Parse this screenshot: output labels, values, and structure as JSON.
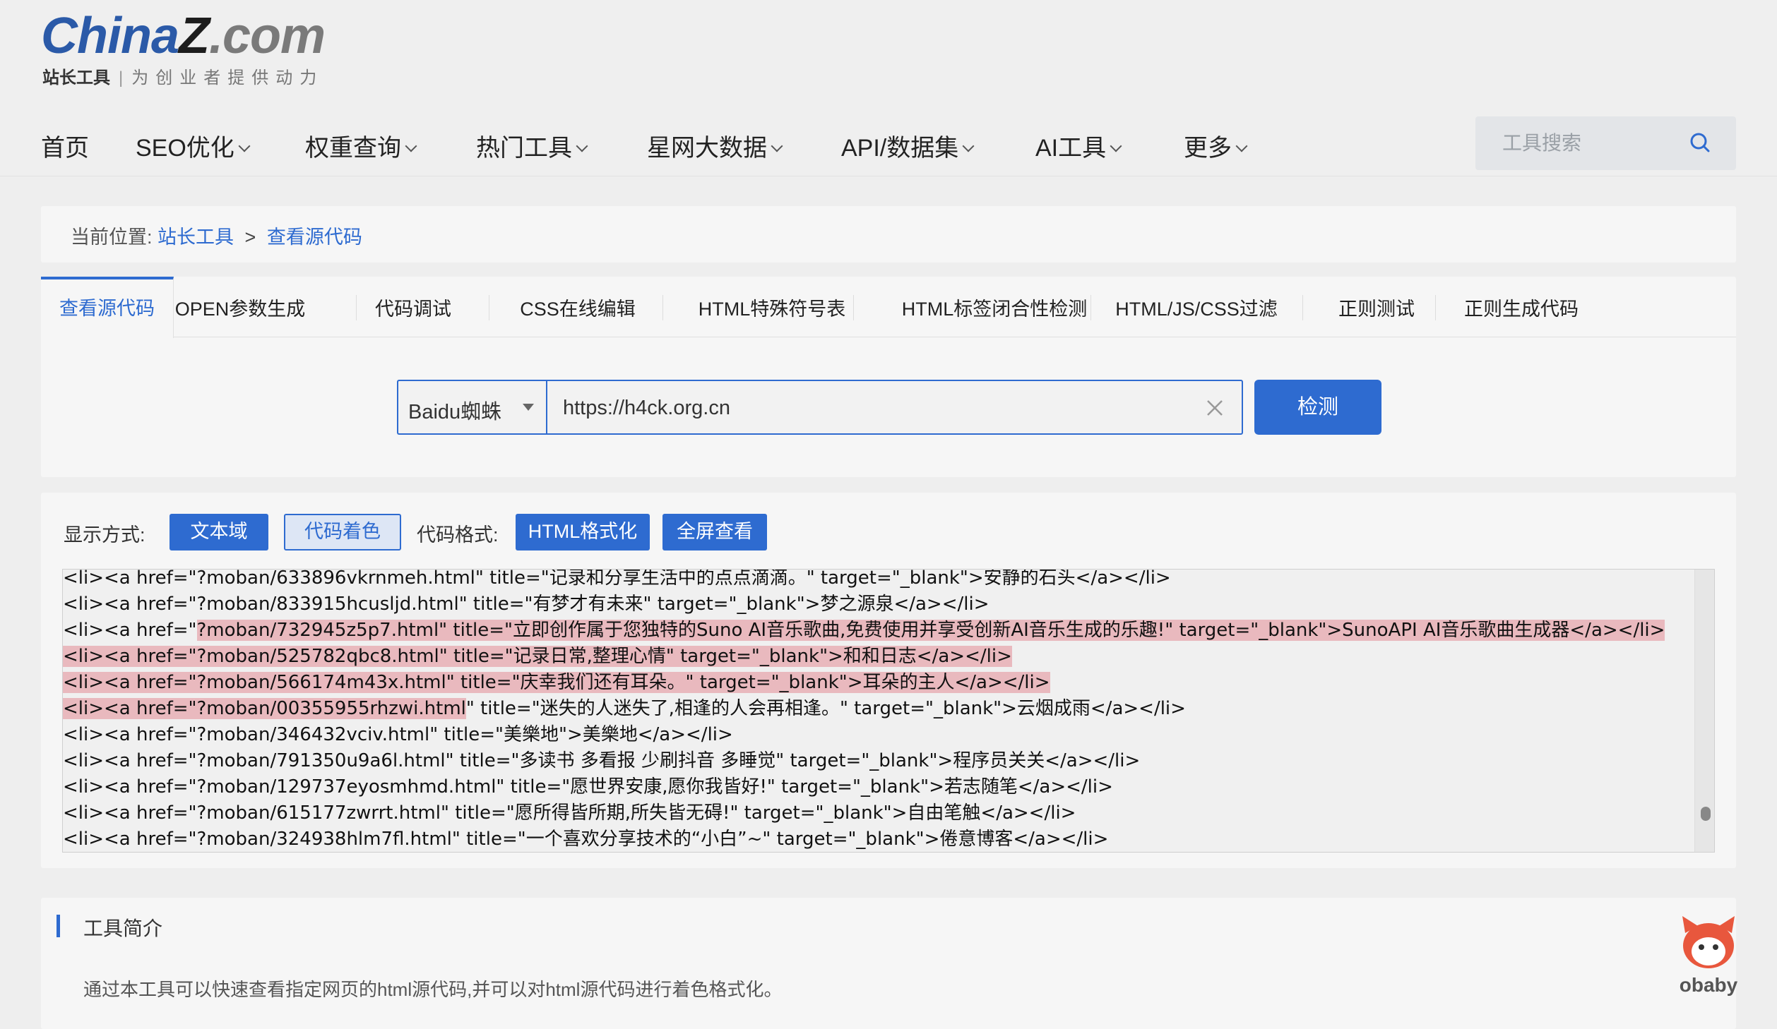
{
  "logo": {
    "brand_part1": "China",
    "brand_part2": "Z",
    "brand_part3": ".com",
    "name": "站长工具",
    "slogan": "为创业者提供动力"
  },
  "nav": {
    "items": [
      {
        "label": "首页",
        "dropdown": false
      },
      {
        "label": "SEO优化",
        "dropdown": true
      },
      {
        "label": "权重查询",
        "dropdown": true
      },
      {
        "label": "热门工具",
        "dropdown": true
      },
      {
        "label": "星网大数据",
        "dropdown": true
      },
      {
        "label": "API/数据集",
        "dropdown": true
      },
      {
        "label": "AI工具",
        "dropdown": true
      },
      {
        "label": "更多",
        "dropdown": true
      }
    ],
    "search_placeholder": "工具搜索"
  },
  "breadcrumb": {
    "prefix": "当前位置:",
    "home": "站长工具",
    "separator": ">",
    "current": "查看源代码"
  },
  "tabs": [
    "查看源代码",
    "OPEN参数生成",
    "代码调试",
    "CSS在线编辑",
    "HTML特殊符号表",
    "HTML标签闭合性检测",
    "HTML/JS/CSS过滤",
    "正则测试",
    "正则生成代码"
  ],
  "form": {
    "ua_selected": "Baidu蜘蛛",
    "url_value": "https://h4ck.org.cn",
    "submit_label": "检测"
  },
  "display": {
    "mode_label": "显示方式:",
    "mode_text": "文本域",
    "mode_color": "代码着色",
    "format_label": "代码格式:",
    "format_html": "HTML格式化",
    "fullscreen": "全屏查看"
  },
  "code_lines": [
    {
      "pre": "<li><a href=\"?moban/633896vkrnmeh.html\" title=\"记录和分享生活中的点点滴滴。\" target=\"_blank\">安静的石头</a></li>",
      "hl": "",
      "post": ""
    },
    {
      "pre": "<li><a href=\"?moban/833915hcusljd.html\" title=\"有梦才有未来\" target=\"_blank\">梦之源泉</a></li>",
      "hl": "",
      "post": ""
    },
    {
      "pre": "<li><a href=\"",
      "hl": "?moban/732945z5p7.html\" title=\"立即创作属于您独特的Suno AI音乐歌曲,免费使用并享受创新AI音乐生成的乐趣!\" target=\"_blank\">SunoAPI AI音乐歌曲生成器</a></li>",
      "post": ""
    },
    {
      "pre": "",
      "hl": "<li><a href=\"?moban/525782qbc8.html\" title=\"记录日常,整理心情\" target=\"_blank\">和和日志</a></li>",
      "post": ""
    },
    {
      "pre": "",
      "hl": "<li><a href=\"?moban/566174m43x.html\" title=\"庆幸我们还有耳朵。\" target=\"_blank\">耳朵的主人</a></li>",
      "post": ""
    },
    {
      "pre": "",
      "hl": "<li><a href=\"?moban/00355955rhzwi.html",
      "post": "\" title=\"迷失的人迷失了,相逢的人会再相逢。\" target=\"_blank\">云烟成雨</a></li>"
    },
    {
      "pre": "<li><a href=\"?moban/346432vciv.html\" title=\"美樂地\">美樂地</a></li>",
      "hl": "",
      "post": ""
    },
    {
      "pre": "<li><a href=\"?moban/791350u9a6l.html\" title=\"多读书 多看报 少刷抖音 多睡觉\" target=\"_blank\">程序员关关</a></li>",
      "hl": "",
      "post": ""
    },
    {
      "pre": "<li><a href=\"?moban/129737eyosmhmd.html\" title=\"愿世界安康,愿你我皆好!\" target=\"_blank\">若志随笔</a></li>",
      "hl": "",
      "post": ""
    },
    {
      "pre": "<li><a href=\"?moban/615177zwrrt.html\" title=\"愿所得皆所期,所失皆无碍!\" target=\"_blank\">自由笔触</a></li>",
      "hl": "",
      "post": ""
    },
    {
      "pre": "<li><a href=\"?moban/324938hlm7fl.html\" title=\"一个喜欢分享技术的“小白”~\" target=\"_blank\">倦意博客</a></li>",
      "hl": "",
      "post": ""
    }
  ],
  "intro": {
    "title": "工具简介",
    "text": "通过本工具可以快速查看指定网页的html源代码,并可以对html源代码进行着色格式化。"
  },
  "watermark": {
    "name": "obaby"
  },
  "colors": {
    "accent": "#2e6bd0",
    "highlight": "#e9b9be",
    "background": "#eeeeee"
  }
}
